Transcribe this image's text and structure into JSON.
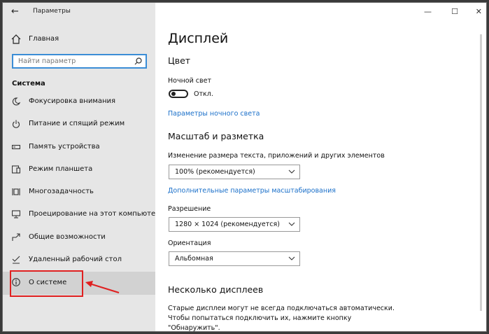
{
  "window": {
    "title": "Параметры",
    "back": "←",
    "minimize": "—",
    "maximize": "☐",
    "close": "✕"
  },
  "sidebar": {
    "home": "Главная",
    "search_placeholder": "Найти параметр",
    "section": "Система",
    "items": [
      {
        "label": "Фокусировка внимания",
        "icon": "moon-icon"
      },
      {
        "label": "Питание и спящий режим",
        "icon": "power-icon"
      },
      {
        "label": "Память устройства",
        "icon": "storage-icon"
      },
      {
        "label": "Режим планшета",
        "icon": "tablet-icon"
      },
      {
        "label": "Многозадачность",
        "icon": "multitask-icon"
      },
      {
        "label": "Проецирование на этот компьютер",
        "icon": "projection-icon"
      },
      {
        "label": "Общие возможности",
        "icon": "shared-icon"
      },
      {
        "label": "Удаленный рабочий стол",
        "icon": "remote-desktop-icon"
      },
      {
        "label": "О системе",
        "icon": "info-icon"
      }
    ],
    "selected_index": 8
  },
  "main": {
    "title": "Дисплей",
    "color_section": "Цвет",
    "night_light_label": "Ночной свет",
    "night_light_state": "Откл.",
    "night_light_link": "Параметры ночного света",
    "scale_section": "Масштаб и разметка",
    "scale_label": "Изменение размера текста, приложений и других элементов",
    "scale_value": "100% (рекомендуется)",
    "scale_link": "Дополнительные параметры масштабирования",
    "resolution_label": "Разрешение",
    "resolution_value": "1280 × 1024 (рекомендуется)",
    "orientation_label": "Ориентация",
    "orientation_value": "Альбомная",
    "multi_section": "Несколько дисплеев",
    "multi_text_1": "Старые дисплеи могут не всегда подключаться автоматически.",
    "multi_text_2": "Чтобы попытаться подключить их, нажмите кнопку",
    "multi_text_3": "\"Обнаружить\"."
  },
  "colors": {
    "accent": "#1a6fc9",
    "highlight": "#e02020"
  }
}
